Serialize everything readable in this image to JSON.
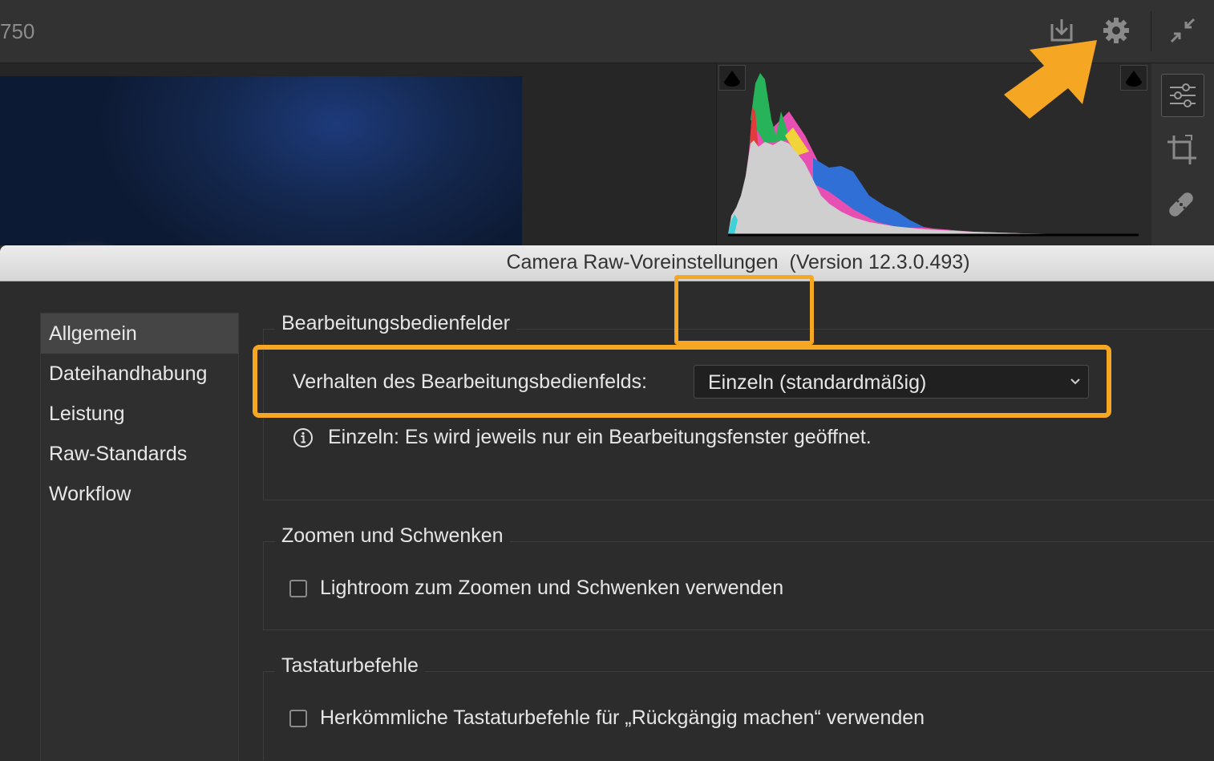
{
  "topbar": {
    "frame_number": "750",
    "icons": [
      "save-icon",
      "gear-icon",
      "collapse-icon"
    ]
  },
  "toolstrip": {
    "tools": [
      "edit-sliders-icon",
      "crop-icon",
      "healing-icon"
    ]
  },
  "dialog": {
    "title": "Camera Raw-Voreinstellungen  (Version 12.3.0.493)"
  },
  "nav": {
    "items": [
      {
        "label": "Allgemein",
        "active": true
      },
      {
        "label": "Dateihandhabung",
        "active": false
      },
      {
        "label": "Leistung",
        "active": false
      },
      {
        "label": "Raw-Standards",
        "active": false
      },
      {
        "label": "Workflow",
        "active": false
      }
    ]
  },
  "groups": {
    "edit_panels": {
      "title": "Bearbeitungsbedienfelder",
      "behavior_label": "Verhalten des Bearbeitungsbedienfelds:",
      "behavior_value": "Einzeln (standardmäßig)",
      "info_text": "Einzeln: Es wird jeweils nur ein Bearbeitungsfenster geöffnet."
    },
    "zoom": {
      "title": "Zoomen und Schwenken",
      "checkbox_label": "Lightroom zum Zoomen und Schwenken verwenden",
      "checked": false
    },
    "shortcuts": {
      "title": "Tastaturbefehle",
      "checkbox_label": "Herkömmliche Tastaturbefehle für „Rückgängig machen“ verwenden",
      "checked": false
    }
  },
  "colors": {
    "highlight": "#f5a623",
    "histogram": [
      "#e23b3b",
      "#27b35a",
      "#2f6fd6",
      "#f0d43a",
      "#e84fb2",
      "#3fd0d8",
      "#cfcfcf"
    ]
  }
}
